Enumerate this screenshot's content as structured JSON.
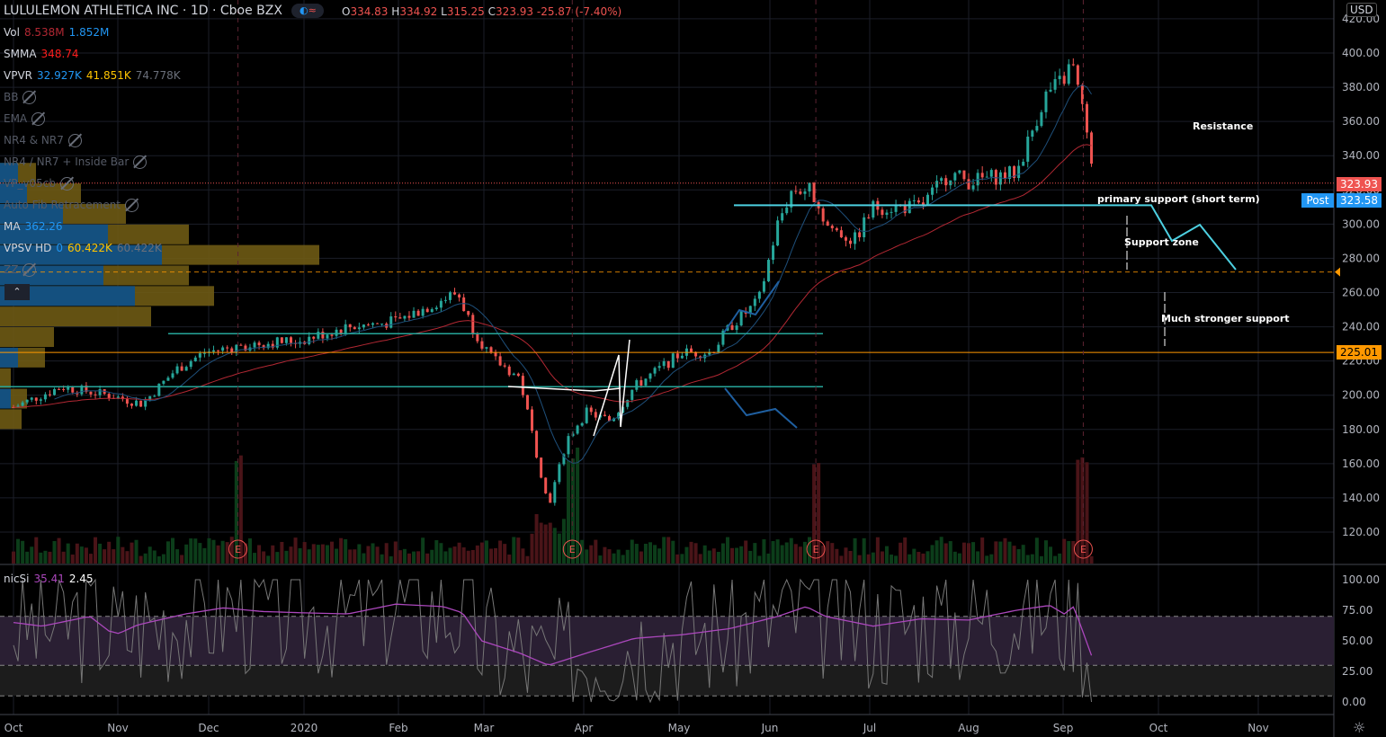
{
  "header": {
    "symbol": "LULULEMON ATHLETICA INC",
    "interval": "1D",
    "exchange": "Cboe BZX",
    "ohlc": {
      "o": "334.83",
      "h": "334.92",
      "l": "315.25",
      "c": "323.93",
      "change": "-25.87",
      "change_pct": "(-7.40%)"
    }
  },
  "legend": [
    {
      "name": "Vol",
      "values": [
        "8.538M",
        "1.852M"
      ],
      "colors": [
        "#b22833",
        "#2196f3"
      ],
      "hidden": false
    },
    {
      "name": "SMMA",
      "values": [
        "348.74"
      ],
      "colors": [
        "#ff1e1e"
      ],
      "hidden": false
    },
    {
      "name": "VPVR",
      "values": [
        "32.927K",
        "41.851K",
        "74.778K"
      ],
      "colors": [
        "#2196f3",
        "#ffc400",
        "#6a6f7a"
      ],
      "hidden": false
    },
    {
      "name": "BB",
      "values": [],
      "colors": [],
      "hidden": true
    },
    {
      "name": "EMA",
      "values": [],
      "colors": [],
      "hidden": true
    },
    {
      "name": "NR4 & NR7",
      "values": [],
      "colors": [],
      "hidden": true
    },
    {
      "name": "NR4 / NR7 + Inside Bar",
      "values": [],
      "colors": [],
      "hidden": true
    },
    {
      "name": "VP_v05cb",
      "values": [],
      "colors": [],
      "hidden": true
    },
    {
      "name": "Auto Fib Retracement",
      "values": [],
      "colors": [],
      "hidden": true
    },
    {
      "name": "MA",
      "values": [
        "362.26"
      ],
      "colors": [
        "#2196f3"
      ],
      "hidden": false
    },
    {
      "name": "VPSV HD",
      "values": [
        "0",
        "60.422K",
        "60.422K"
      ],
      "colors": [
        "#2196f3",
        "#ffc400",
        "#6a6f7a"
      ],
      "hidden": false
    },
    {
      "name": "ZZ",
      "values": [],
      "colors": [],
      "hidden": true
    }
  ],
  "currency": "USD",
  "price_tags": {
    "last": "323.93",
    "post_label": "Post",
    "post": "323.58",
    "level": "225.01"
  },
  "annotations": {
    "resistance": "Resistance",
    "primary": "primary support (short term)",
    "zone": "Support zone",
    "stronger": "Much stronger support"
  },
  "earnings_marker": "E",
  "oscillator": {
    "name": "nicSi",
    "value1": "35.41",
    "value2": "2.45"
  },
  "colors": {
    "up": "#26a69a",
    "down": "#ef5350",
    "smma": "#b22833",
    "ma": "#2196f3",
    "osc": "#ab47bc",
    "level": "#ff9800",
    "support": "#4dd0e1"
  },
  "chart_data": {
    "type": "candlestick",
    "title": "LULULEMON ATHLETICA INC · 1D · Cboe BZX",
    "x_ticks": [
      "Oct",
      "Nov",
      "Dec",
      "2020",
      "Feb",
      "Mar",
      "Apr",
      "May",
      "Jun",
      "Jul",
      "Aug",
      "Sep",
      "Oct",
      "Nov"
    ],
    "y_ticks": [
      120,
      140,
      160,
      180,
      200,
      220,
      240,
      260,
      280,
      300,
      320,
      340,
      360,
      380,
      400,
      420
    ],
    "ylim": [
      110,
      425
    ],
    "close_waypoints_month_index": [
      [
        0,
        193
      ],
      [
        0.5,
        205
      ],
      [
        1,
        200
      ],
      [
        1.35,
        195
      ],
      [
        1.7,
        215
      ],
      [
        2,
        225
      ],
      [
        2.5,
        230
      ],
      [
        3,
        232
      ],
      [
        3.5,
        240
      ],
      [
        4,
        243
      ],
      [
        4.65,
        260
      ],
      [
        4.8,
        240
      ],
      [
        5,
        222
      ],
      [
        5.3,
        210
      ],
      [
        5.5,
        160
      ],
      [
        5.6,
        135
      ],
      [
        5.8,
        175
      ],
      [
        6,
        190
      ],
      [
        6.25,
        185
      ],
      [
        6.5,
        205
      ],
      [
        7,
        225
      ],
      [
        7.3,
        225
      ],
      [
        7.5,
        240
      ],
      [
        7.8,
        255
      ],
      [
        8,
        300
      ],
      [
        8.15,
        320
      ],
      [
        8.35,
        320
      ],
      [
        8.5,
        300
      ],
      [
        8.8,
        290
      ],
      [
        9,
        310
      ],
      [
        9.5,
        310
      ],
      [
        9.8,
        330
      ],
      [
        10,
        325
      ],
      [
        10.5,
        330
      ],
      [
        10.8,
        375
      ],
      [
        11,
        385
      ],
      [
        11.08,
        395
      ],
      [
        11.25,
        350
      ],
      [
        11.3,
        324
      ]
    ],
    "earnings_month_index": [
      2.35,
      5.85,
      8.4,
      11.2
    ],
    "levels": {
      "last": 323.93,
      "post": 323.58,
      "orange_solid": 225.01,
      "orange_dashed": 272,
      "primary_support": 311,
      "support_236": 236,
      "support_205": 205
    },
    "volume_profile": [
      [
        330,
        20,
        40
      ],
      [
        318,
        30,
        90
      ],
      [
        306,
        70,
        140
      ],
      [
        294,
        120,
        210
      ],
      [
        282,
        180,
        355
      ],
      [
        270,
        115,
        210
      ],
      [
        258,
        150,
        238
      ],
      [
        246,
        0,
        168
      ],
      [
        234,
        0,
        60
      ],
      [
        222,
        20,
        50
      ],
      [
        210,
        0,
        12
      ],
      [
        198,
        12,
        30
      ],
      [
        186,
        0,
        24
      ]
    ],
    "oscillator": {
      "ylim": [
        -8,
        108
      ],
      "y_ticks": [
        0,
        25,
        50,
        75,
        100
      ],
      "bands": [
        70,
        30,
        5
      ],
      "signal_waypoints_month_index": [
        [
          0,
          65
        ],
        [
          0.3,
          62
        ],
        [
          0.8,
          70
        ],
        [
          1,
          58
        ],
        [
          1.1,
          56
        ],
        [
          1.3,
          63
        ],
        [
          1.8,
          72
        ],
        [
          2.2,
          77
        ],
        [
          2.6,
          74
        ],
        [
          3,
          73
        ],
        [
          3.5,
          72
        ],
        [
          4,
          80
        ],
        [
          4.5,
          78
        ],
        [
          4.7,
          73
        ],
        [
          4.9,
          50
        ],
        [
          5.3,
          40
        ],
        [
          5.6,
          30
        ],
        [
          6,
          40
        ],
        [
          6.5,
          52
        ],
        [
          7,
          55
        ],
        [
          7.5,
          60
        ],
        [
          8,
          70
        ],
        [
          8.3,
          78
        ],
        [
          8.5,
          70
        ],
        [
          9,
          62
        ],
        [
          9.5,
          68
        ],
        [
          10,
          67
        ],
        [
          10.5,
          75
        ],
        [
          10.85,
          79
        ],
        [
          11,
          72
        ],
        [
          11.1,
          78
        ],
        [
          11.3,
          35
        ]
      ]
    }
  }
}
